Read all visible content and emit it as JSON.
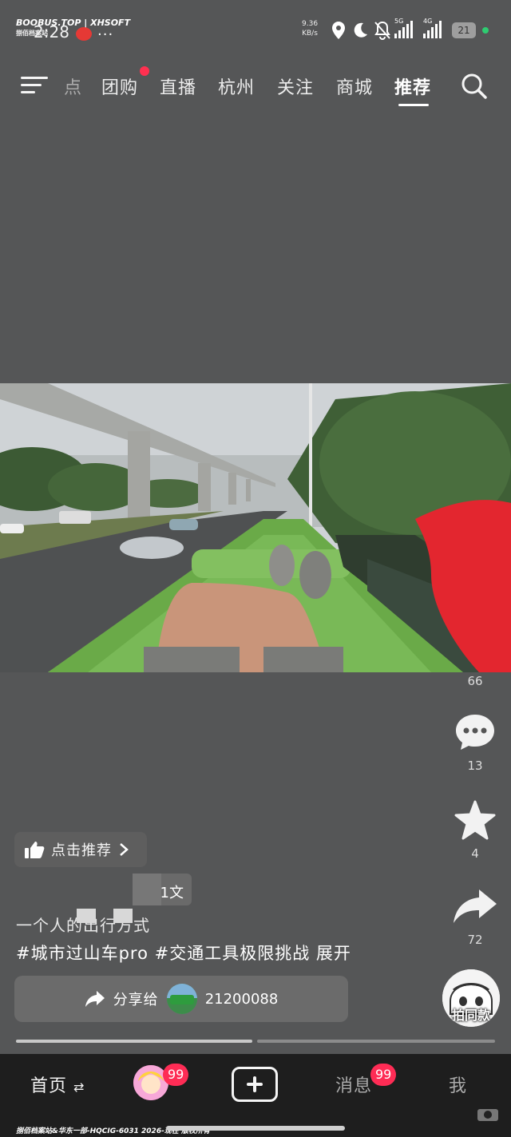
{
  "watermark": {
    "top_line": "BOOBUS.TOP | XHSOFT",
    "top_sub": "捌佰档案站",
    "bottom": "捌佰档案站&华东一部-HQCIG-6031 2026-现在 版权所有"
  },
  "status_bar": {
    "time": "2:28",
    "more": "...",
    "net_speed_value": "9.36",
    "net_speed_unit": "KB/s",
    "signal1_label": "5G",
    "signal2_label": "4G",
    "battery": "21",
    "icons": [
      "location-icon",
      "moon-icon",
      "mute-bell-icon",
      "signal-icon",
      "battery-icon"
    ]
  },
  "top_nav": {
    "partial": "点",
    "items": [
      "团购",
      "直播",
      "杭州",
      "关注",
      "商城",
      "推荐"
    ],
    "active": "推荐",
    "dot_color": "#ff3050"
  },
  "video": {
    "recommend_label": "点击推荐",
    "author_suffix": "1文",
    "caption": "一个人的出行方式",
    "hashtags": "#城市过山车pro #交通工具极限挑战",
    "expand": "展开",
    "share_label": "分享给",
    "share_target": "21200088",
    "progress_percent": 50
  },
  "side_rail": {
    "likes": "66",
    "comments": "13",
    "favorites": "4",
    "shares": "72",
    "same_style_label": "拍同款"
  },
  "bottom_nav": {
    "home": "首页",
    "home_suffix": "⇄",
    "friends_badge": "99",
    "messages": "消息",
    "messages_badge": "99",
    "me": "我"
  },
  "colors": {
    "accent": "#fe2c55",
    "background": "#555657",
    "bottom_bar": "#1e1e1e"
  }
}
